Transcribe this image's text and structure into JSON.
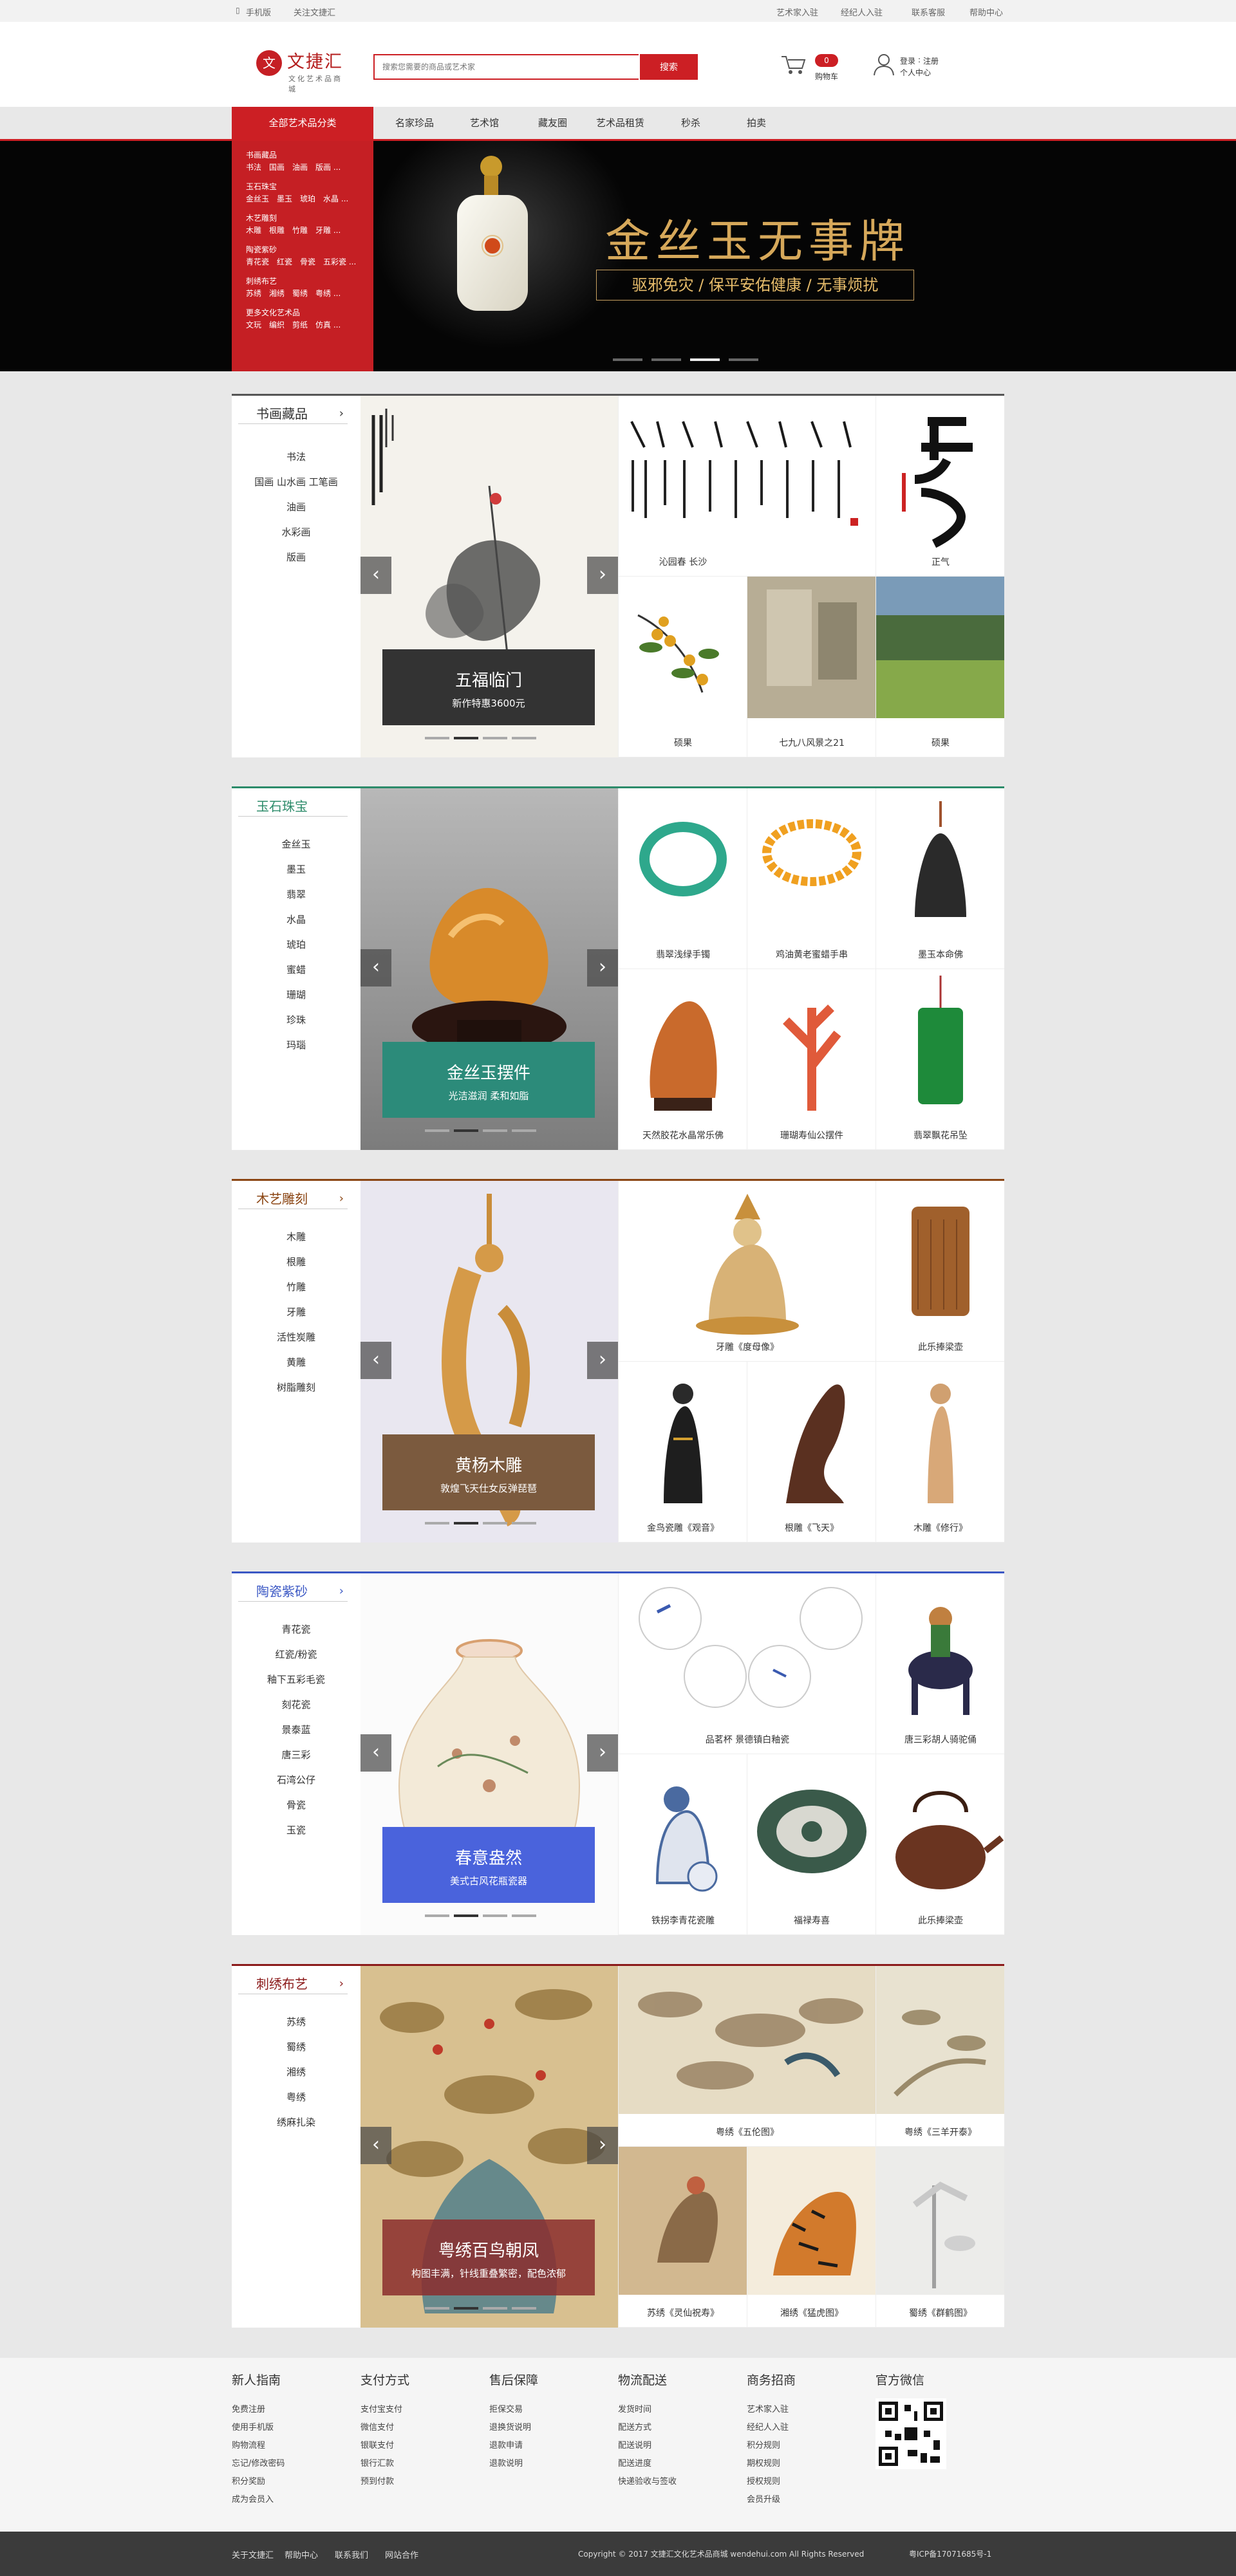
{
  "topbar": {
    "mobile": "手机版",
    "follow": "关注文捷汇",
    "artist": "艺术家入驻",
    "broker": "经纪人入驻",
    "service": "联系客服",
    "help": "帮助中心"
  },
  "logo": {
    "name": "文捷汇",
    "sub": "文化艺术品商城"
  },
  "search": {
    "placeholder": "搜索您需要的商品或艺术家",
    "button": "搜索"
  },
  "cart": {
    "label": "购物车",
    "count": "0"
  },
  "account": {
    "login": "登录",
    "register": "注册",
    "center": "个人中心"
  },
  "nav": {
    "all": "全部艺术品分类",
    "items": [
      "名家珍品",
      "艺术馆",
      "藏友圈",
      "艺术品租赁",
      "秒杀",
      "拍卖"
    ]
  },
  "menu": [
    {
      "h": "书画藏品",
      "s": "书法　国画　油画　版画 ..."
    },
    {
      "h": "玉石珠宝",
      "s": "金丝玉　墨玉　琥珀　水晶 ..."
    },
    {
      "h": "木艺雕刻",
      "s": "木雕　根雕　竹雕　牙雕 ..."
    },
    {
      "h": "陶瓷紫砂",
      "s": "青花瓷　红瓷　骨瓷　五彩瓷 ..."
    },
    {
      "h": "刺绣布艺",
      "s": "苏绣　湘绣　蜀绣　粤绣 ..."
    },
    {
      "h": "更多文化艺术品",
      "s": "文玩　编织　剪纸　仿真 ..."
    }
  ],
  "banner": {
    "title": "金丝玉无事牌",
    "subtitle": "驱邪免灾 / 保平安佑健康 / 无事烦扰"
  },
  "sections": [
    {
      "title": "书画藏品",
      "color": "#333333",
      "list": [
        "书法",
        "国画 山水画 工笔画",
        "油画",
        "水彩画",
        "版画"
      ],
      "feature": {
        "t": "五福临门",
        "d": "新作特惠3600元"
      },
      "cells": [
        "沁园春 长沙",
        "正气",
        "硕果",
        "七九八风景之21",
        "硕果"
      ]
    },
    {
      "title": "玉石珠宝",
      "color": "#2c8b6a",
      "list": [
        "金丝玉",
        "墨玉",
        "翡翠",
        "水晶",
        "琥珀",
        "蜜蜡",
        "珊瑚",
        "珍珠",
        "玛瑙"
      ],
      "feature": {
        "t": "金丝玉摆件",
        "d": "光洁滋润 柔和如脂"
      },
      "cells": [
        "翡翠浅绿手镯",
        "鸡油黄老蜜蜡手串",
        "墨玉本命佛",
        "天然胶花水晶常乐佛",
        "珊瑚寿仙公摆件",
        "翡翠飘花吊坠"
      ]
    },
    {
      "title": "木艺雕刻",
      "color": "#8b4513",
      "list": [
        "木雕",
        "根雕",
        "竹雕",
        "牙雕",
        "活性炭雕",
        "黄雕",
        "树脂雕刻"
      ],
      "feature": {
        "t": "黄杨木雕",
        "d": "敦煌飞天仕女反弹琵琶"
      },
      "cells": [
        "牙雕《度母像》",
        "此乐捧梁壶",
        "金鸟瓷雕《观音》",
        "根雕《飞天》",
        "木雕《修行》"
      ]
    },
    {
      "title": "陶瓷紫砂",
      "color": "#3a57c4",
      "list": [
        "青花瓷",
        "红瓷/粉瓷",
        "釉下五彩毛瓷",
        "刻花瓷",
        "景泰蓝",
        "唐三彩",
        "石湾公仔",
        "骨瓷",
        "玉瓷"
      ],
      "feature": {
        "t": "春意盎然",
        "d": "美式古风花瓶瓷器"
      },
      "cells": [
        "品茗杯 景德镇白釉瓷",
        "唐三彩胡人骑驼俑",
        "铁拐李青花瓷雕",
        "福禄寿喜",
        "此乐捧梁壶"
      ]
    },
    {
      "title": "刺绣布艺",
      "color": "#8b1a1a",
      "list": [
        "苏绣",
        "蜀绣",
        "湘绣",
        "粤绣",
        "绣麻扎染"
      ],
      "feature": {
        "t": "粤绣百鸟朝凤",
        "d": "构图丰满，针线重叠繁密，配色浓郁"
      },
      "cells": [
        "粤绣《五伦图》",
        "粤绣《三羊开泰》",
        "苏绣《灵仙祝寿》",
        "湘绣《猛虎图》",
        "蜀绣《群鹤图》"
      ]
    }
  ],
  "footer": {
    "cols": [
      {
        "h": "新人指南",
        "l": [
          "免费注册",
          "使用手机版",
          "购物流程",
          "忘记/修改密码",
          "积分奖励",
          "成为会员入"
        ]
      },
      {
        "h": "支付方式",
        "l": [
          "支付宝支付",
          "微信支付",
          "银联支付",
          "银行汇款",
          "预到付款"
        ]
      },
      {
        "h": "售后保障",
        "l": [
          "拒保交易",
          "退换货说明",
          "退款申请",
          "退款说明"
        ]
      },
      {
        "h": "物流配送",
        "l": [
          "发货时间",
          "配送方式",
          "配送说明",
          "配送进度",
          "快递验收与签收"
        ]
      },
      {
        "h": "商务招商",
        "l": [
          "艺术家入驻",
          "经纪人入驻",
          "积分规则",
          "期权规则",
          "授权规则",
          "会员升级"
        ]
      },
      {
        "h": "官方微信",
        "l": []
      }
    ]
  },
  "bottom": {
    "about": "关于文捷汇",
    "help": "帮助中心",
    "contact": "联系我们",
    "coop": "网站合作",
    "copyright": "Copyright © 2017 文捷汇文化艺术品商城 wendehui.com All Rights Reserved",
    "icp": "粤ICP备17071685号-1"
  }
}
